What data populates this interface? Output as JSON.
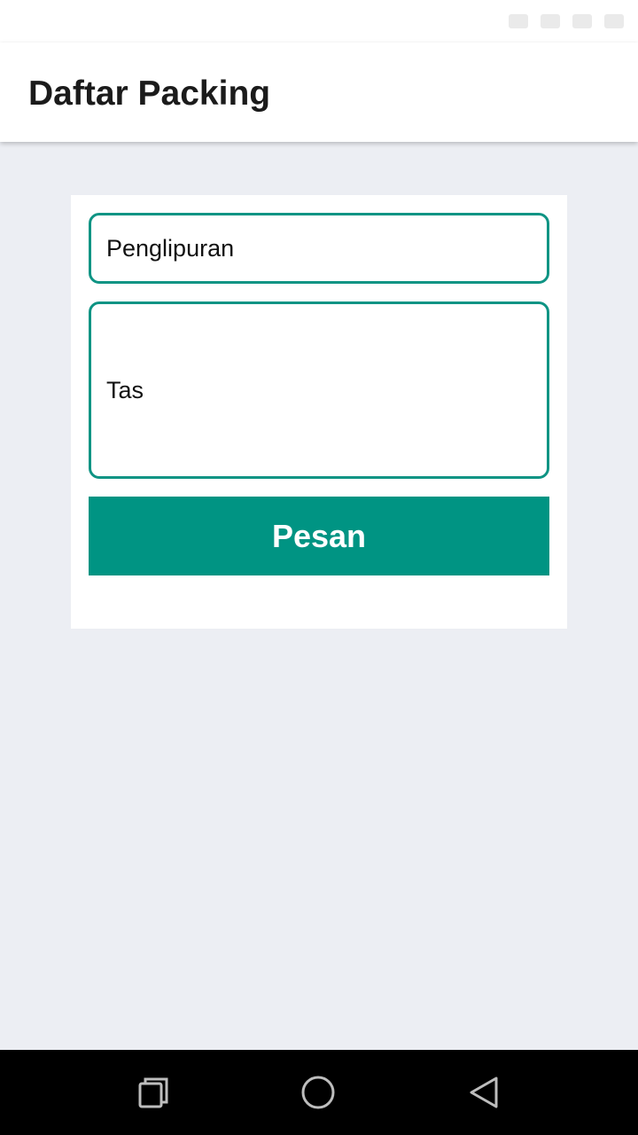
{
  "app_bar": {
    "title": "Daftar Packing"
  },
  "form": {
    "destination_value": "Penglipuran",
    "item_value": "Tas",
    "submit_label": "Pesan"
  },
  "colors": {
    "accent": "#009483",
    "background": "#eceef3",
    "app_bar": "#ffffff",
    "nav_bar": "#000000"
  },
  "nav": {
    "icons": [
      "recents-icon",
      "home-icon",
      "back-icon"
    ]
  }
}
